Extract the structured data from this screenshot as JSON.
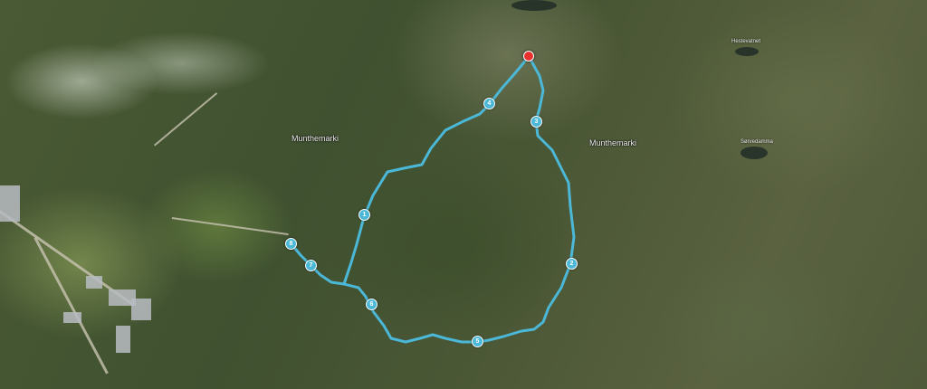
{
  "map": {
    "type": "satellite",
    "labels": {
      "munthemarki_west": "Munthemarki",
      "munthemarki_east": "Munthemarki",
      "lake_top_right": "Hestevatnet",
      "lake_right": "Sørvedamma",
      "lake_top_center": "",
      "road_label": ""
    },
    "route": {
      "color": "#4cb8d8",
      "start_marker_color": "#e8322e",
      "markers": [
        {
          "label": "1"
        },
        {
          "label": "2"
        },
        {
          "label": "3"
        },
        {
          "label": "4"
        },
        {
          "label": "5"
        },
        {
          "label": "6"
        },
        {
          "label": "7"
        },
        {
          "label": "8"
        }
      ]
    }
  }
}
